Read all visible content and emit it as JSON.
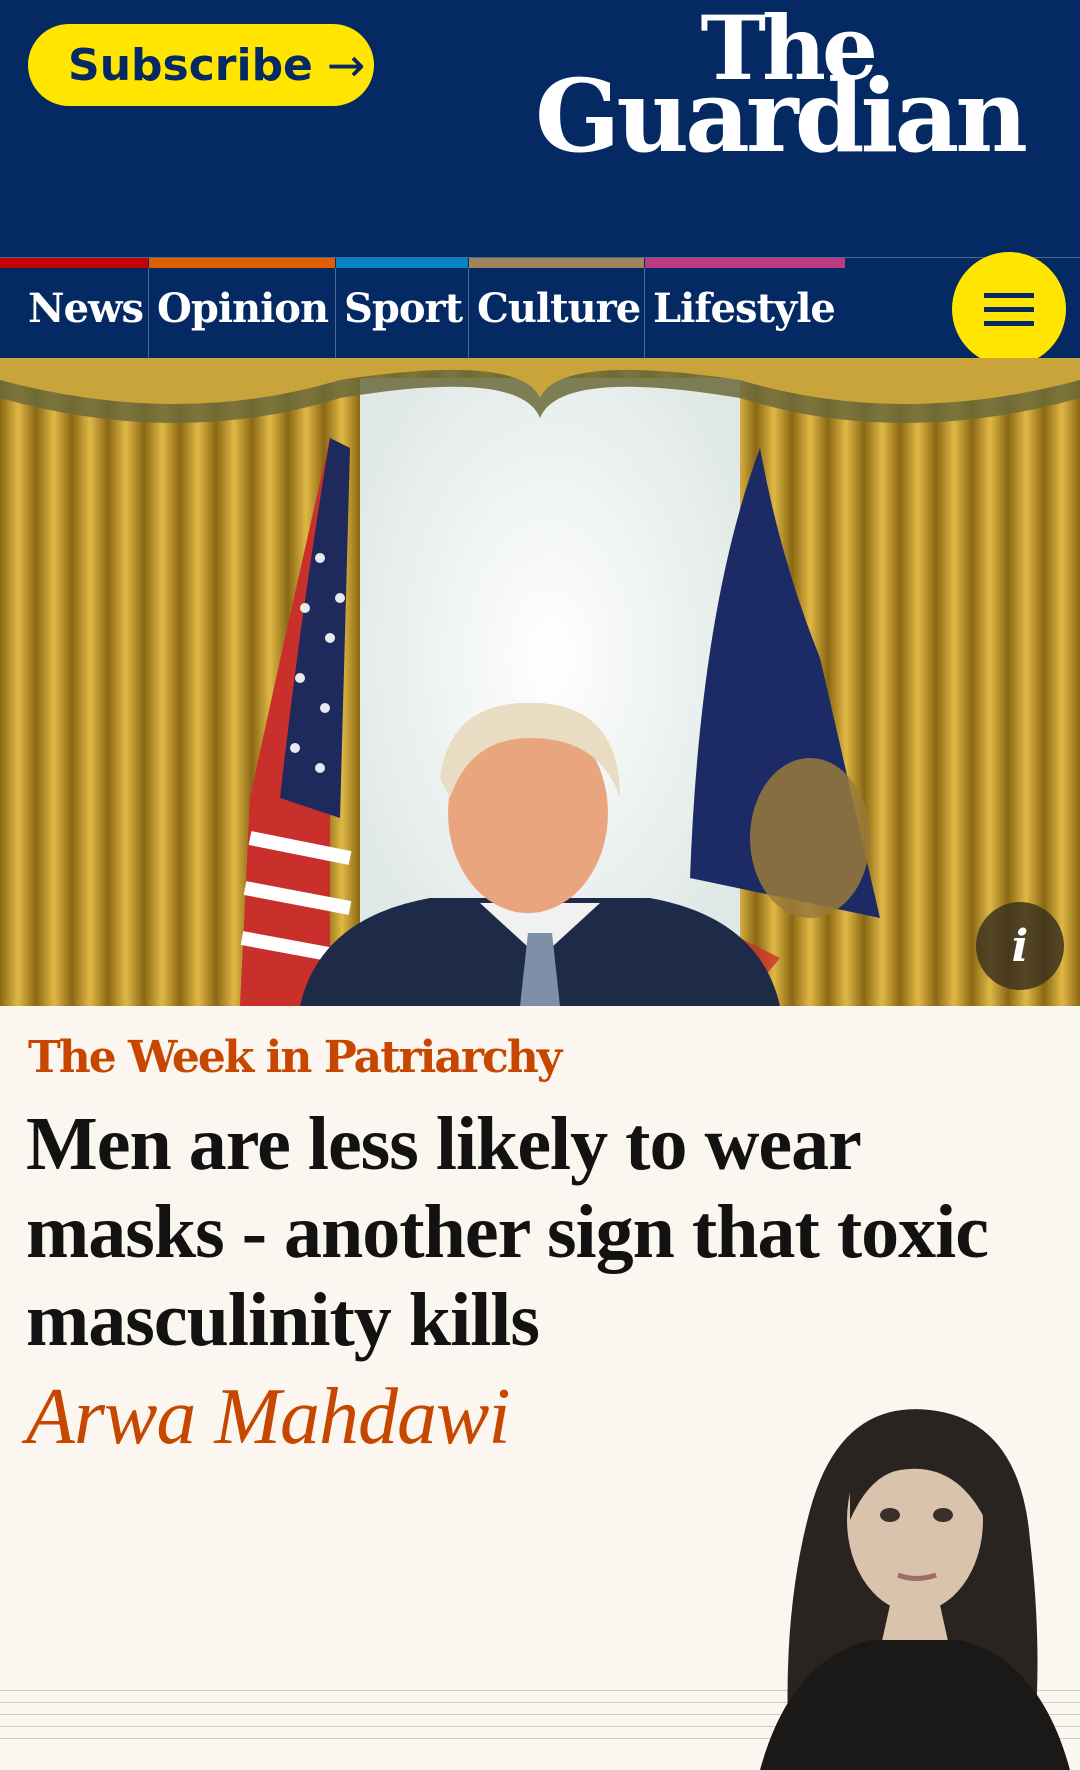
{
  "header": {
    "subscribe_label": "Subscribe",
    "subscribe_arrow": "→",
    "logo_line1": "The",
    "logo_line2": "Guardian"
  },
  "nav": {
    "items": [
      {
        "label": "News",
        "color": "#c70000"
      },
      {
        "label": "Opinion",
        "color": "#e05e00"
      },
      {
        "label": "Sport",
        "color": "#0084c6"
      },
      {
        "label": "Culture",
        "color": "#a1845c"
      },
      {
        "label": "Lifestyle",
        "color": "#bb3b80"
      }
    ],
    "menu_icon": "hamburger-icon"
  },
  "hero": {
    "info_label": "i"
  },
  "article": {
    "kicker": "The Week in Patriarchy",
    "headline": "Men are less likely to wear masks - another sign that toxic masculinity kills",
    "byline": "Arwa Mahdawi"
  },
  "colors": {
    "brand_navy": "#052962",
    "brand_yellow": "#ffe500",
    "opinion_orange": "#c74600",
    "page_bg": "#fbf6ef"
  }
}
